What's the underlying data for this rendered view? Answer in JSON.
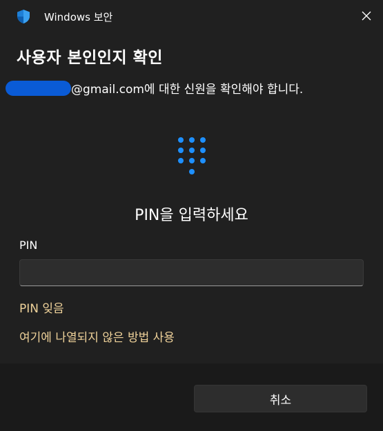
{
  "window": {
    "title": "Windows 보안",
    "close_icon": "close-icon"
  },
  "dialog": {
    "heading": "사용자 본인인지 확인",
    "email_text": "@gmail.com에 대한 신원을 확인해야 합니다.",
    "pin_prompt": "PIN을 입력하세요",
    "pin_label": "PIN",
    "pin_value": "",
    "forgot_pin": "PIN 잊음",
    "other_method": "여기에 나열되지 않은 방법 사용"
  },
  "footer": {
    "cancel_label": "취소"
  },
  "colors": {
    "background": "#202020",
    "footer": "#1a1a1a",
    "accent": "#1e90ff",
    "link": "#efd29a",
    "redaction": "#0a5bd6"
  },
  "icons": {
    "app": "shield-icon",
    "keypad": "pin-keypad-icon"
  }
}
